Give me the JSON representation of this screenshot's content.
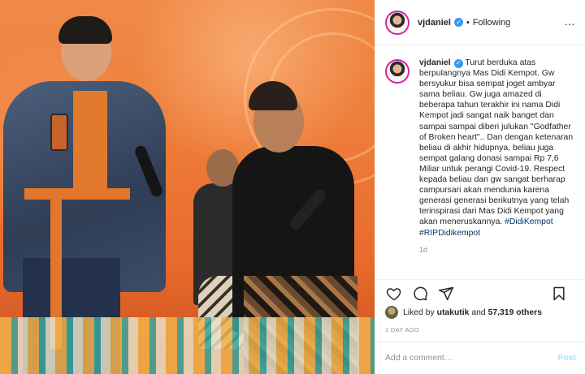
{
  "header": {
    "username": "vjdaniel",
    "separator": "•",
    "follow_status": "Following",
    "more_icon": "…"
  },
  "caption": {
    "username": "vjdaniel",
    "text": "Turut berduka atas berpulangnya Mas Didi Kempot. Gw bersyukur bisa sempat joget ambyar sama beliau. Gw juga amazed di beberapa tahun terakhir ini nama Didi Kempot jadi sangat naik banget dan sampai sampai diberi julukan \"Godfather of Broken heart\".. Dan dengan ketenaran beliau di akhir hidupnya, beliau juga sempat galang donasi sampai Rp 7,6 Miliar untuk perangi Covid-19. Respect kepada beliau dan gw sangat berharap campursari akan mendunia karena generasi generasi berikutnya yang telah terinspirasi dari Mas Didi Kempot yang akan meneruskannya.",
    "tag1": "#DidiKempot",
    "tag2": "#RIPDidikempot",
    "age": "1d"
  },
  "likes": {
    "prefix": "Liked by",
    "user": "utakutik",
    "connector": "and",
    "count": "57,319 others"
  },
  "date": "1 DAY AGO",
  "comment_box": {
    "placeholder": "Add a comment…",
    "post_label": "Post"
  },
  "colors": {
    "verified": "#3897f0",
    "link": "#00376b",
    "post_disabled": "#b2dffc",
    "photo_bg": "#ee7d3a"
  }
}
